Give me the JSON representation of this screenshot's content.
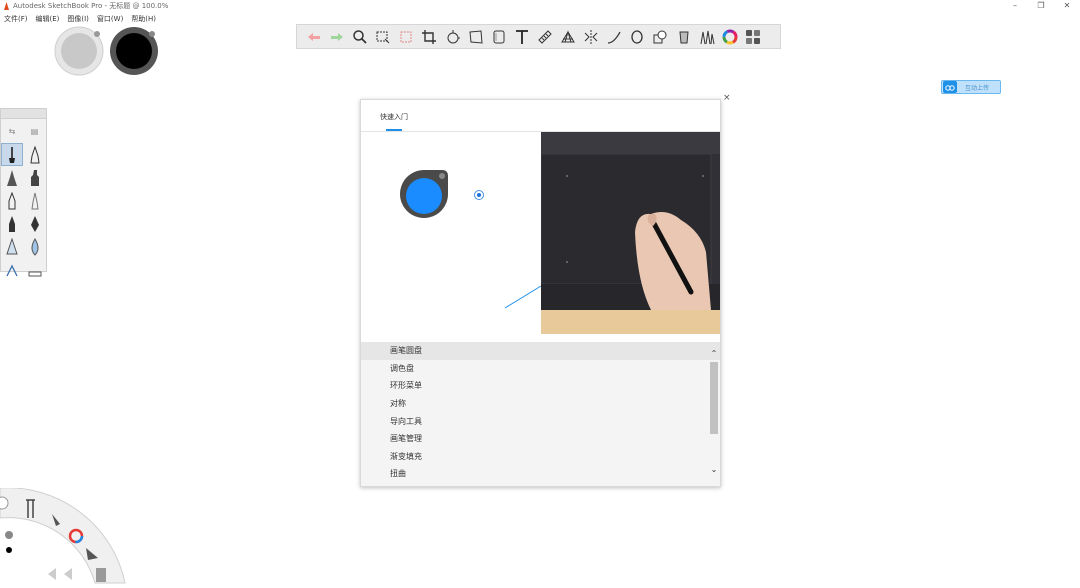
{
  "window": {
    "title": "Autodesk SketchBook Pro - 无标题 @ 100.0%",
    "controls": [
      "–",
      "❐",
      "✕"
    ]
  },
  "menu": [
    "文件(F)",
    "编辑(E)",
    "图像(I)",
    "窗口(W)",
    "帮助(H)"
  ],
  "colors": {
    "accent": "#1e90e8",
    "toolbar_bg": "#ececec",
    "puck_blue": "#1a8cff",
    "list_bg": "#f4f4f4"
  },
  "color_pucks": [
    {
      "name": "secondary-color-puck",
      "color": "#d8d8d8"
    },
    {
      "name": "primary-color-puck",
      "color": "#000000"
    }
  ],
  "toolbar": {
    "icons": [
      "undo-icon",
      "redo-icon",
      "zoom-icon",
      "select-icon",
      "lasso-select-icon",
      "crop-icon",
      "transform-icon",
      "distort-icon",
      "layer-icon",
      "text-icon",
      "ruler-icon",
      "perspective-icon",
      "symmetry-icon",
      "curve-icon",
      "ellipse-icon",
      "shape-icon",
      "fill-icon",
      "brush-library-icon",
      "color-wheel-icon",
      "copic-library-icon"
    ]
  },
  "upload_button": {
    "label": "互动上传"
  },
  "brush_palette": {
    "tabs": [
      "⇆",
      "▤"
    ],
    "brushes": [
      "pencil",
      "ballpoint-pen",
      "marker",
      "felt-pen",
      "pen",
      "airbrush",
      "ink-pen",
      "nib",
      "paint",
      "water-drop",
      "text-brush",
      "eraser"
    ]
  },
  "dialog": {
    "tab_label": "快速入门",
    "close": "×",
    "list_items": [
      "画笔圆盘",
      "调色盘",
      "环形菜单",
      "对称",
      "导向工具",
      "画笔管理",
      "渐变填充",
      "扭曲"
    ],
    "active_index": 0,
    "scroll_up": "⌃",
    "scroll_down": "⌄"
  }
}
